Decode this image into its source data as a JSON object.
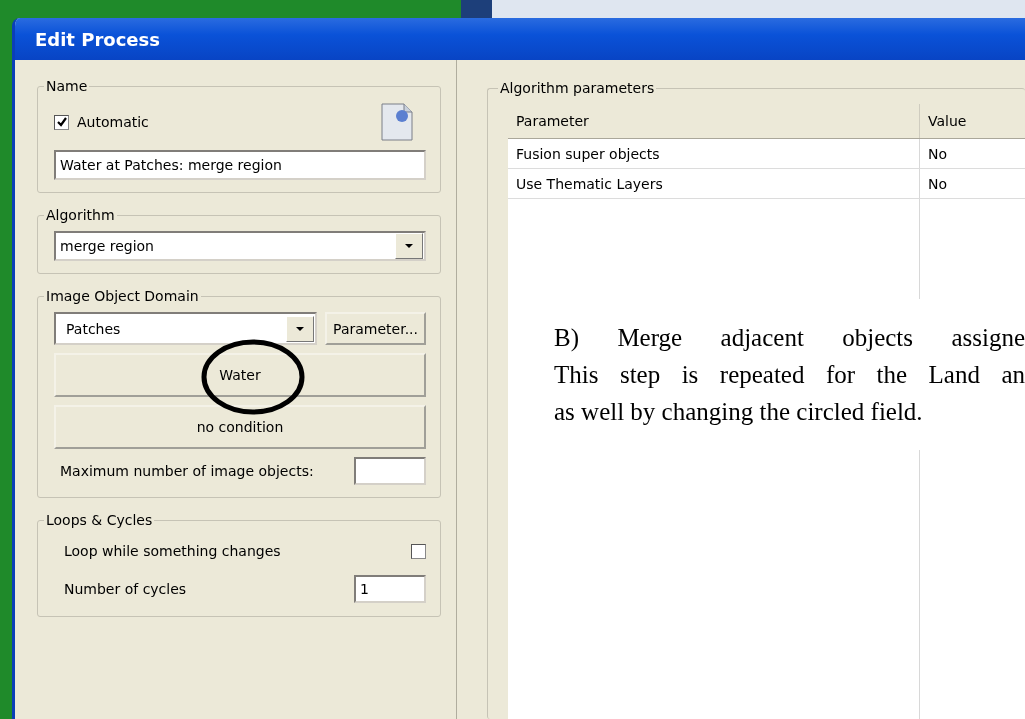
{
  "window": {
    "title": "Edit Process"
  },
  "name_group": {
    "label": "Name",
    "automatic": {
      "label": "Automatic",
      "checked": true
    },
    "value": "Water at Patches: merge region"
  },
  "algorithm_group": {
    "label": "Algorithm",
    "value": "merge region"
  },
  "domain_group": {
    "label": "Image Object Domain",
    "domain": "Patches",
    "parameter_button": "Parameter...",
    "class_button": "Water",
    "condition_button": "no condition",
    "max_objects": {
      "label": "Maximum number of image objects:"
    }
  },
  "loops_group": {
    "label": "Loops & Cycles",
    "loop": {
      "label": "Loop while something changes",
      "checked": false
    },
    "cycles": {
      "label": "Number of cycles",
      "value": "1"
    }
  },
  "parameters_group": {
    "label": "Algorithm parameters",
    "columns": [
      "Parameter",
      "Value"
    ],
    "rows": [
      [
        "Fusion super objects",
        "No"
      ],
      [
        "Use Thematic Layers",
        "No"
      ]
    ]
  },
  "annotation": {
    "lines": [
      "B) Merge adjacent objects assigne",
      "This step is repeated for the Land an",
      "as well by changing the circled field."
    ]
  }
}
